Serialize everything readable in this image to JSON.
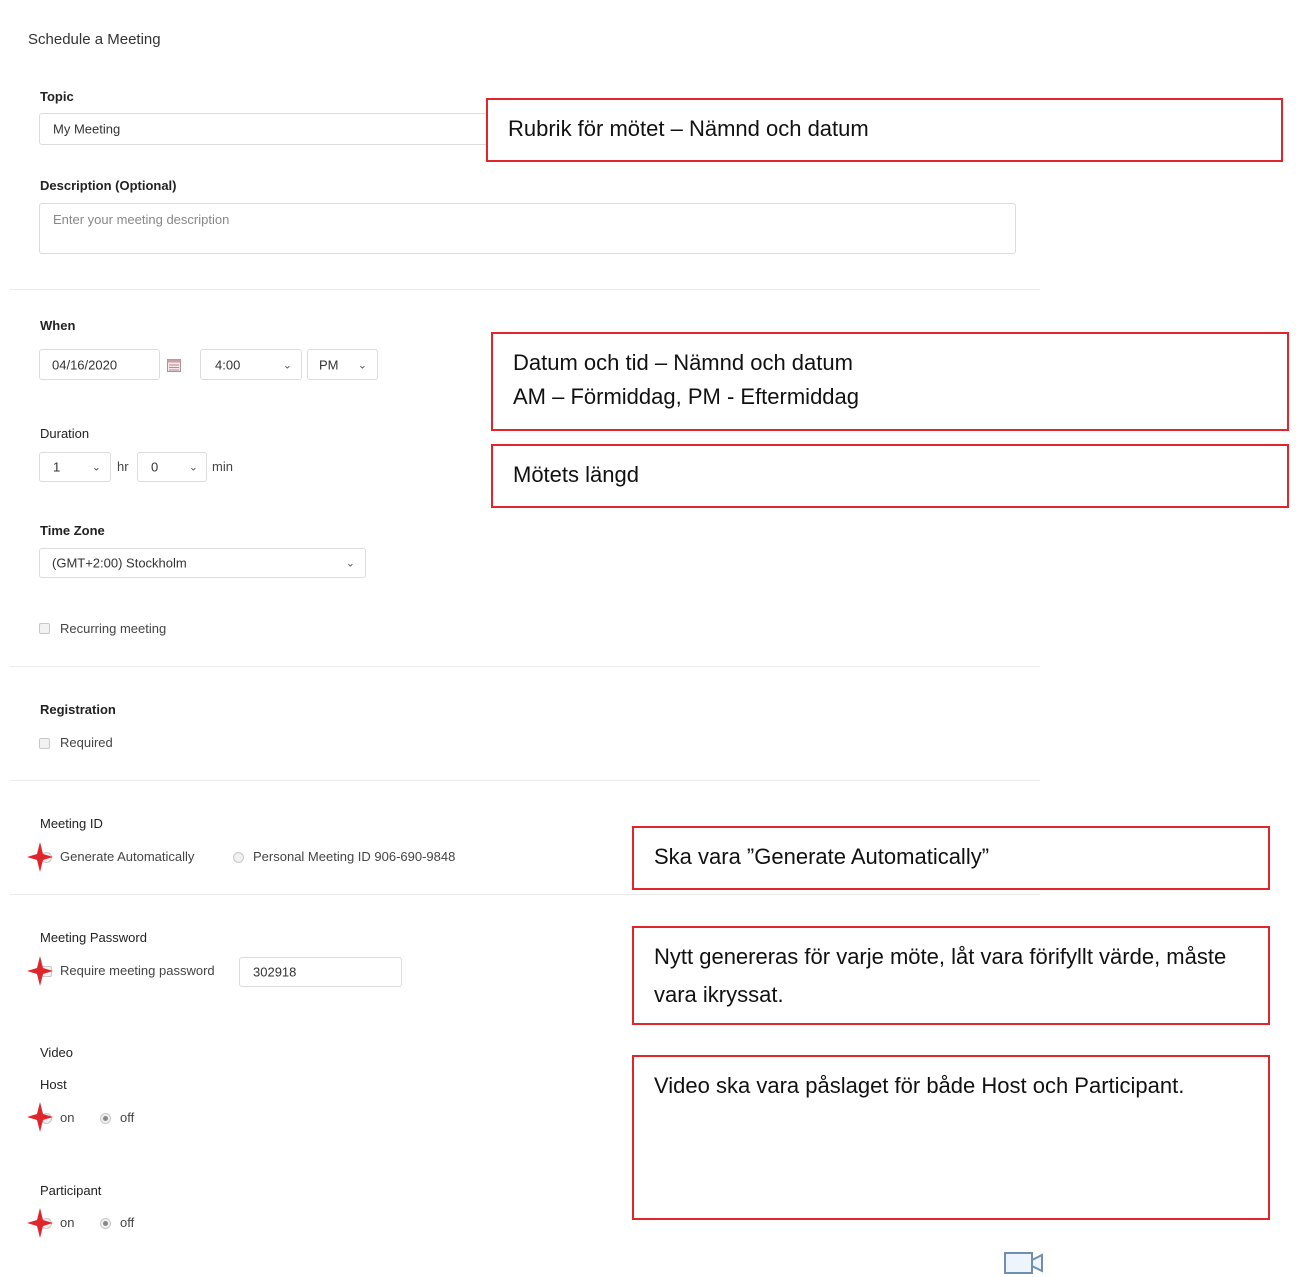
{
  "page": {
    "title": "Schedule a Meeting"
  },
  "topic": {
    "label": "Topic",
    "value": "My Meeting"
  },
  "description": {
    "label": "Description (Optional)",
    "placeholder": "Enter your meeting description"
  },
  "when": {
    "label": "When",
    "date": "04/16/2020",
    "time": "4:00",
    "ampm": "PM"
  },
  "duration": {
    "label": "Duration",
    "hours": "1",
    "hr_label": "hr",
    "minutes": "0",
    "min_label": "min"
  },
  "timezone": {
    "label": "Time Zone",
    "value": "(GMT+2:00) Stockholm"
  },
  "recurring": {
    "label": "Recurring meeting",
    "checked": false
  },
  "registration": {
    "label": "Registration",
    "required_label": "Required",
    "checked": false
  },
  "meeting_id": {
    "label": "Meeting ID",
    "option_auto": "Generate Automatically",
    "option_personal": "Personal Meeting ID 906-690-9848"
  },
  "password": {
    "label": "Meeting Password",
    "require_label": "Require meeting password",
    "value": "302918"
  },
  "video": {
    "label": "Video",
    "host": {
      "label": "Host",
      "on": "on",
      "off": "off",
      "selected": "off"
    },
    "participant": {
      "label": "Participant",
      "on": "on",
      "off": "off",
      "selected": "off"
    }
  },
  "callouts": {
    "topic": "Rubrik för mötet – Nämnd och datum",
    "when_line1": "Datum och tid – Nämnd och datum",
    "when_line2": "AM – Förmiddag, PM - Eftermiddag",
    "duration": "Mötets längd",
    "meeting_id": "Ska vara ”Generate Automatically”",
    "password": "Nytt genereras för varje möte, låt vara förifyllt värde, måste vara ikryssat.",
    "video": "Video ska vara påslaget för både Host och Participant."
  },
  "colors": {
    "annotation_red": "#e0252b",
    "border": "#dcdcdc"
  },
  "icons": [
    "calendar-icon",
    "chevron-down-icon",
    "red-star-marker-icon",
    "video-icon"
  ]
}
